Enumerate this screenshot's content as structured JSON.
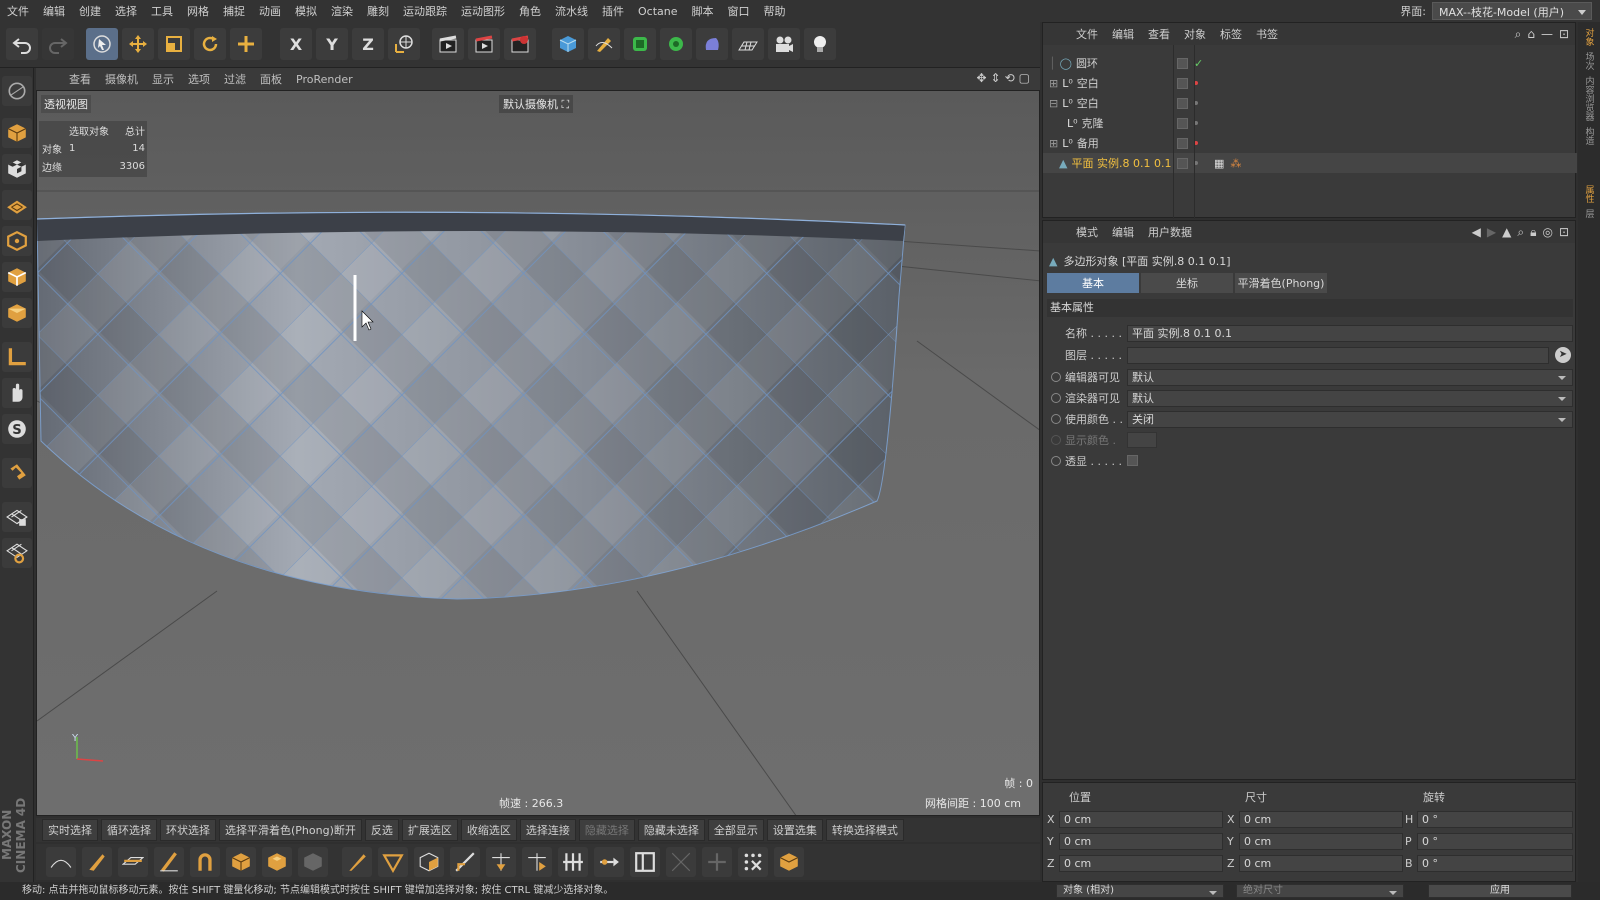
{
  "menubar": {
    "items": [
      "文件",
      "编辑",
      "创建",
      "选择",
      "工具",
      "网格",
      "捕捉",
      "动画",
      "模拟",
      "渲染",
      "雕刻",
      "运动跟踪",
      "运动图形",
      "角色",
      "流水线",
      "插件",
      "Octane",
      "脚本",
      "窗口",
      "帮助"
    ],
    "layout_label": "界面:",
    "layout_value": "MAX--枝花-Model (用户)"
  },
  "toolbar": {
    "axis_x": "X",
    "axis_y": "Y",
    "axis_z": "Z"
  },
  "viewport": {
    "menu": [
      "查看",
      "摄像机",
      "显示",
      "选项",
      "过滤",
      "面板",
      "ProRender"
    ],
    "label": "透视视图",
    "camera": "默认摄像机",
    "stats": {
      "header_col1": "选取对象",
      "header_col2": "总计",
      "row1_label": "对象",
      "row1_sel": "1",
      "row1_total": "14",
      "row2_label": "边缘",
      "row2_total": "3306"
    },
    "fps": "帧速 : 266.3",
    "grid": "网格间距 : 100 cm",
    "frame": "帧 : 0",
    "axis_y_label": "Y"
  },
  "selection_bar": {
    "buttons": [
      "实时选择",
      "循环选择",
      "环状选择",
      "选择平滑着色(Phong)断开",
      "反选",
      "扩展选区",
      "收缩选区",
      "选择连接",
      "隐藏选择",
      "隐藏未选择",
      "全部显示",
      "设置选集",
      "转换选择模式"
    ],
    "disabled": [
      8
    ]
  },
  "brand": "MAXON CINEMA 4D",
  "statusbar": "移动: 点击并拖动鼠标移动元素。按住 SHIFT 键量化移动; 节点编辑模式时按住 SHIFT 键增加选择对象; 按住 CTRL 键减少选择对象。",
  "object_manager": {
    "menu": [
      "文件",
      "编辑",
      "查看",
      "对象",
      "标签",
      "书签"
    ],
    "objects": [
      {
        "name": "圆环"
      },
      {
        "name": "空白"
      },
      {
        "name": "空白"
      },
      {
        "name": "克隆"
      },
      {
        "name": "备用"
      },
      {
        "name": "平面 实例.8 0.1 0.1"
      }
    ]
  },
  "attribute_manager": {
    "menu": [
      "模式",
      "编辑",
      "用户数据"
    ],
    "title": "多边形对象 [平面 实例.8 0.1 0.1]",
    "tabs": [
      "基本",
      "坐标",
      "平滑着色(Phong)"
    ],
    "section": "基本属性",
    "props": [
      {
        "label": "名称 . . . . .",
        "value": "平面 实例.8 0.1 0.1"
      },
      {
        "label": "图层 . . . . .",
        "value": ""
      },
      {
        "label": "编辑器可见",
        "value": "默认"
      },
      {
        "label": "渲染器可见",
        "value": "默认"
      },
      {
        "label": "使用颜色 . .",
        "value": "关闭"
      },
      {
        "label": "显示颜色 .",
        "value": ""
      },
      {
        "label": "透显 . . . . .",
        "value": ""
      }
    ]
  },
  "coord_manager": {
    "headers": [
      "位置",
      "尺寸",
      "旋转"
    ],
    "pos": [
      "0 cm",
      "0 cm",
      "0 cm"
    ],
    "size": [
      "0 cm",
      "0 cm",
      "0 cm"
    ],
    "rot": [
      "0 °",
      "0 °",
      "0 °"
    ],
    "pos_axes": [
      "X",
      "Y",
      "Z"
    ],
    "size_axes": [
      "X",
      "Y",
      "Z"
    ],
    "rot_axes": [
      "H",
      "P",
      "B"
    ],
    "mode": "对象 (相对)",
    "size_mode": "绝对尺寸",
    "apply": "应用"
  },
  "right_strip": [
    "对象",
    "场次",
    "内容浏览器",
    "构造",
    "属性",
    "层"
  ]
}
